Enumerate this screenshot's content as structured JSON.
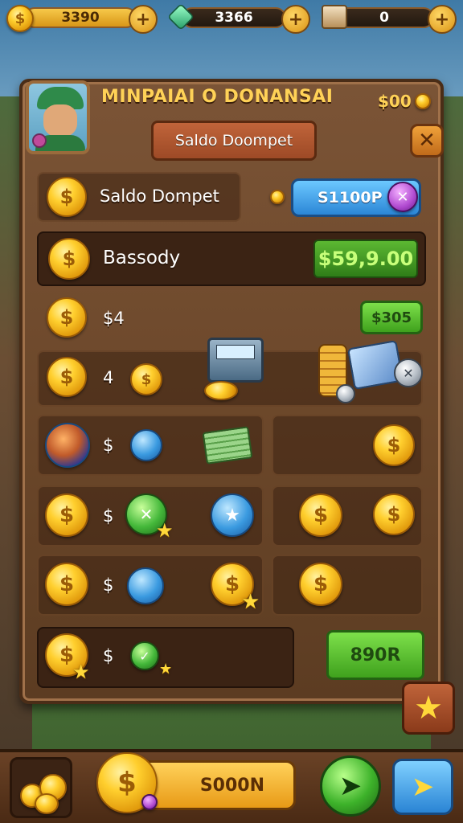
{
  "top_bar": {
    "gold_amount": "3390",
    "gem_amount": "3366",
    "crate_amount": "0",
    "plus_symbol": "+"
  },
  "panel": {
    "title": "MINPAIAI O DONANSAI",
    "title_amount": "$00",
    "tab_header": "Saldo Doompet",
    "close_symbol": "✕"
  },
  "rows": {
    "saldo": {
      "label": "Saldo Dompet",
      "button": "S1100P"
    },
    "balance": {
      "label": "Bassody",
      "value": "$59,9.00"
    },
    "row3": {
      "label": "$4",
      "button": "$305"
    },
    "row4": {
      "label": "4"
    },
    "row5": {
      "label": "$"
    },
    "row6": {
      "label": "$"
    },
    "row7": {
      "label": "$"
    },
    "row8": {
      "label": "$",
      "button": "890R"
    }
  },
  "bottom_bar": {
    "amount": "S000N"
  },
  "icons": {
    "coin_glyph": "$",
    "star_glyph": "★"
  },
  "colors": {
    "panel_wood": "#6a4629",
    "gold": "#ffcf2e",
    "green_button": "#3fa11d",
    "blue_button": "#2b86d6"
  }
}
